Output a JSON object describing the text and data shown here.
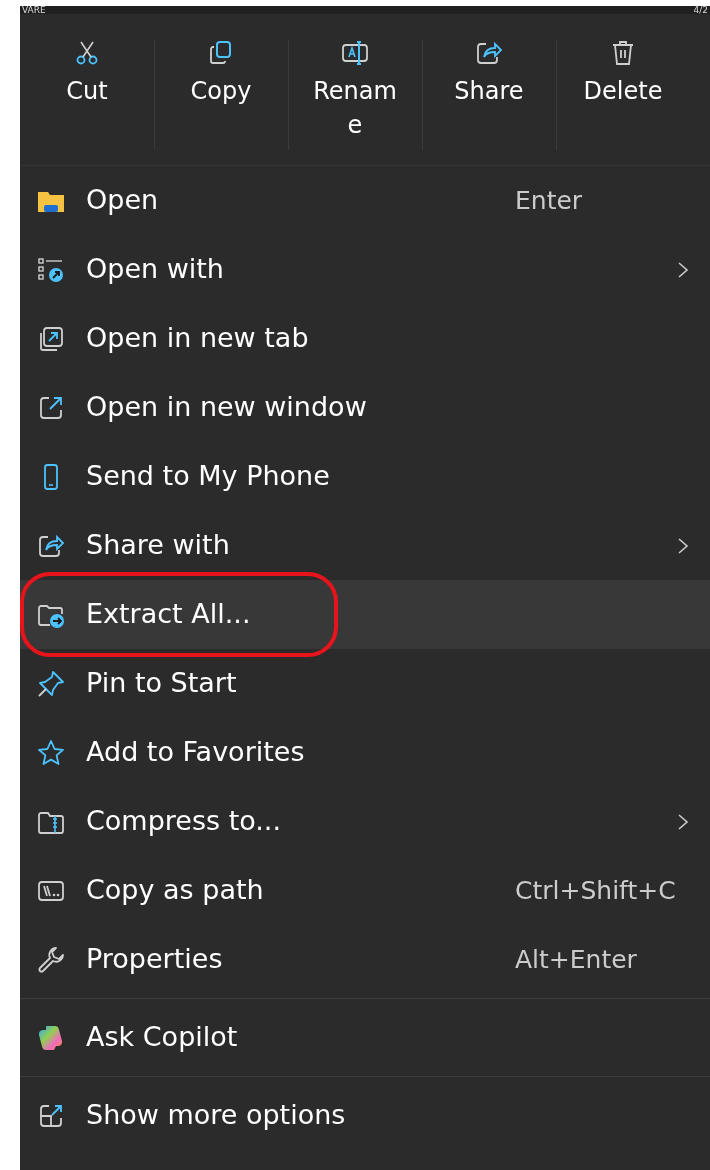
{
  "background_texts": [
    "VARE",
    "4/2"
  ],
  "toolbar": [
    {
      "kind": "scissors",
      "label": "Cut"
    },
    {
      "kind": "copy",
      "label": "Copy"
    },
    {
      "kind": "rename",
      "label": "Rename"
    },
    {
      "kind": "share",
      "label": "Share"
    },
    {
      "kind": "trash",
      "label": "Delete"
    }
  ],
  "menu_sections": [
    {
      "items": [
        {
          "kind": "folder",
          "label": "Open",
          "shortcut": "Enter",
          "submenu": false,
          "selected": false,
          "annotated": false
        },
        {
          "kind": "openwith",
          "label": "Open with",
          "submenu": true,
          "selected": false,
          "annotated": false
        },
        {
          "kind": "newtab",
          "label": "Open in new tab",
          "submenu": false,
          "selected": false,
          "annotated": false
        },
        {
          "kind": "newwindow",
          "label": "Open in new window",
          "submenu": false,
          "selected": false,
          "annotated": false
        },
        {
          "kind": "phone",
          "label": "Send to My Phone",
          "submenu": false,
          "selected": false,
          "annotated": false
        },
        {
          "kind": "share",
          "label": "Share with",
          "submenu": true,
          "selected": false,
          "annotated": false
        },
        {
          "kind": "extract",
          "label": "Extract All...",
          "submenu": false,
          "selected": true,
          "annotated": true
        },
        {
          "kind": "pin",
          "label": "Pin to Start",
          "submenu": false,
          "selected": false,
          "annotated": false
        },
        {
          "kind": "star",
          "label": "Add to Favorites",
          "submenu": false,
          "selected": false,
          "annotated": false
        },
        {
          "kind": "zip",
          "label": "Compress to...",
          "submenu": true,
          "selected": false,
          "annotated": false
        },
        {
          "kind": "path",
          "label": "Copy as path",
          "shortcut": "Ctrl+Shift+C",
          "submenu": false,
          "selected": false,
          "annotated": false
        },
        {
          "kind": "wrench",
          "label": "Properties",
          "shortcut": "Alt+Enter",
          "submenu": false,
          "selected": false,
          "annotated": false
        }
      ]
    },
    {
      "items": [
        {
          "kind": "copilot",
          "label": "Ask Copilot",
          "submenu": false,
          "selected": false,
          "annotated": false
        }
      ]
    },
    {
      "items": [
        {
          "kind": "more",
          "label": "Show more options",
          "submenu": false,
          "selected": false,
          "annotated": false
        }
      ]
    }
  ]
}
